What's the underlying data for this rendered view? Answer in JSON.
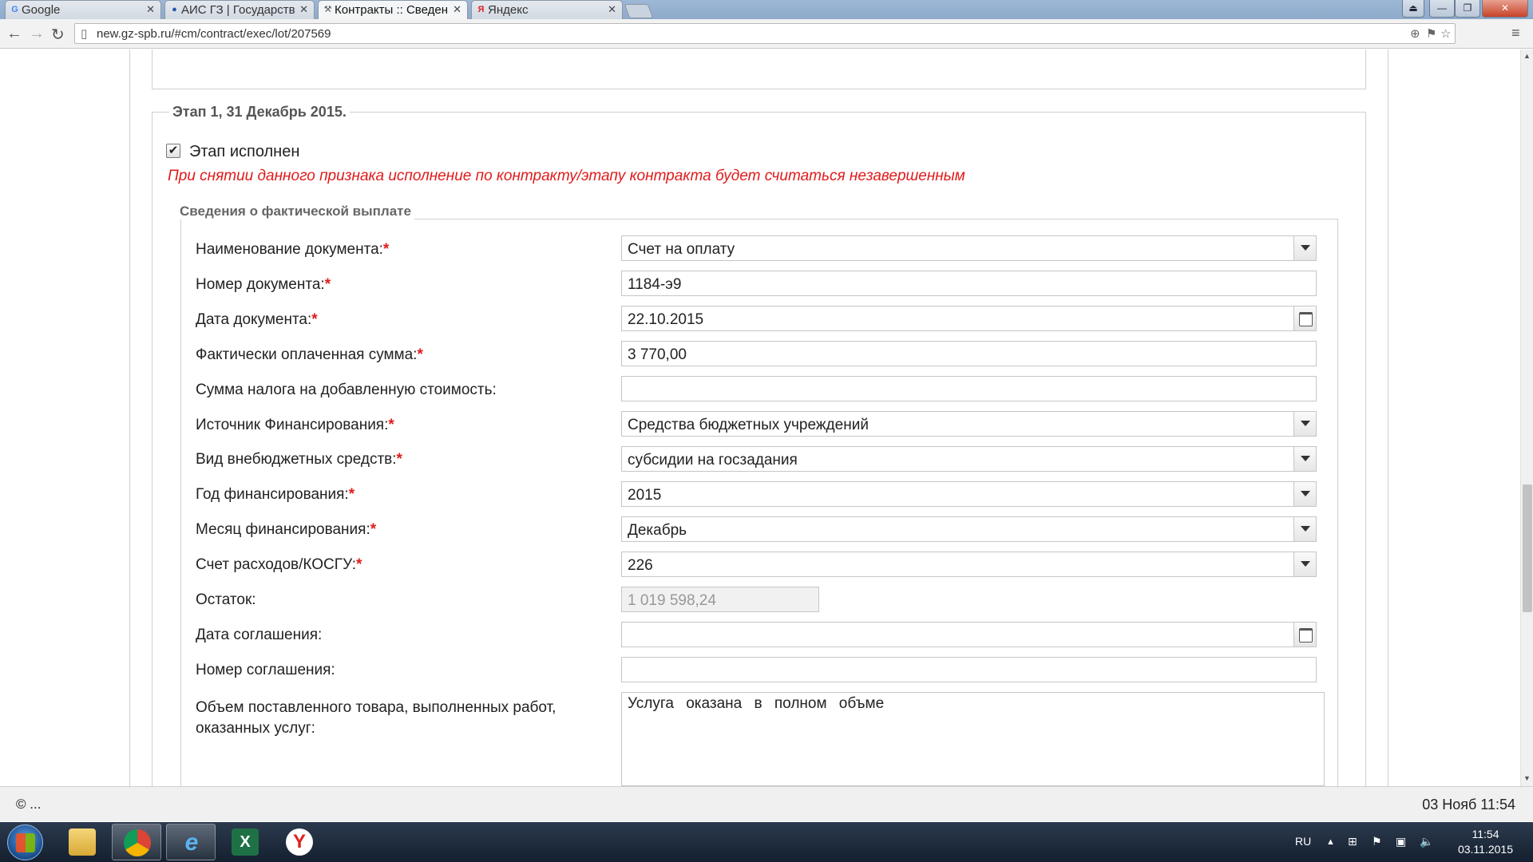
{
  "browser": {
    "tabs": [
      {
        "label": "Google",
        "favicon": "G"
      },
      {
        "label": "АИС ГЗ | Государств",
        "favicon": "globe"
      },
      {
        "label": "Контракты :: Сведен",
        "favicon": "tools"
      },
      {
        "label": "Яндекс",
        "favicon": "Я"
      }
    ],
    "url": "new.gz-spb.ru/#cm/contract/exec/lot/207569"
  },
  "stage": {
    "title": "Этап 1, 31 Декабрь 2015.",
    "checkbox_label": "Этап исполнен",
    "checked": true,
    "warning": "При снятии данного признака исполнение по контракту/этапу контракта будет считаться незавершенным"
  },
  "payment": {
    "title": "Сведения о фактической выплате",
    "fields": [
      {
        "label": "Наименование документа:",
        "required": true,
        "value": "Счет на оплату",
        "type": "select"
      },
      {
        "label": "Номер документа:",
        "required": true,
        "value": "1184-э9",
        "type": "text"
      },
      {
        "label": "Дата документа:",
        "required": true,
        "value": "22.10.2015",
        "type": "date"
      },
      {
        "label": "Фактически оплаченная сумма:",
        "required": true,
        "value": "3 770,00",
        "type": "text"
      },
      {
        "label": "Сумма налога на добавленную стоимость:",
        "required": false,
        "value": "",
        "type": "text"
      },
      {
        "label": "Источник Финансирования:",
        "required": true,
        "value": "Средства бюджетных учреждений",
        "type": "select"
      },
      {
        "label": "Вид внебюджетных средств:",
        "required": true,
        "value": "субсидии на госзадания",
        "type": "select"
      },
      {
        "label": "Год финансирования:",
        "required": true,
        "value": "2015",
        "type": "select"
      },
      {
        "label": "Месяц финансирования:",
        "required": true,
        "value": "Декабрь",
        "type": "select"
      },
      {
        "label": "Счет расходов/КОСГУ:",
        "required": true,
        "value": "226",
        "type": "select"
      },
      {
        "label": "Остаток:",
        "required": false,
        "value": "1 019 598,24",
        "type": "readonly"
      },
      {
        "label": "Дата соглашения:",
        "required": false,
        "value": "",
        "type": "date"
      },
      {
        "label": "Номер соглашения:",
        "required": false,
        "value": "",
        "type": "text"
      }
    ],
    "volume_label_1": "Объем поставленного товара, выполненных работ,",
    "volume_label_2": "оказанных услуг:",
    "volume_value": "Услуга оказана в полном объме"
  },
  "status": {
    "copyright": "© ...",
    "datetime": "03 Нояб 11:54"
  },
  "taskbar": {
    "lang": "RU",
    "time": "11:54",
    "date": "03.11.2015"
  }
}
